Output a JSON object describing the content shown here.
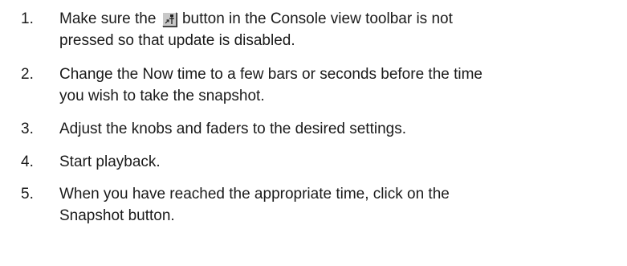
{
  "steps": [
    {
      "number": "1.",
      "text_before_icon": "Make sure the ",
      "icon": "update-automation-icon",
      "line1_after_icon": " button in the Console view toolbar is not",
      "line2": "pressed so that update is disabled."
    },
    {
      "number": "2.",
      "line1": "Change the Now time to a few bars or seconds before the time",
      "line2": "you wish to take the snapshot."
    },
    {
      "number": "3.",
      "line1": "Adjust the knobs and faders to the desired settings."
    },
    {
      "number": "4.",
      "line1": "Start playback."
    },
    {
      "number": "5.",
      "line1": "When you have reached the appropriate time, click on the",
      "line2": "Snapshot button."
    }
  ]
}
